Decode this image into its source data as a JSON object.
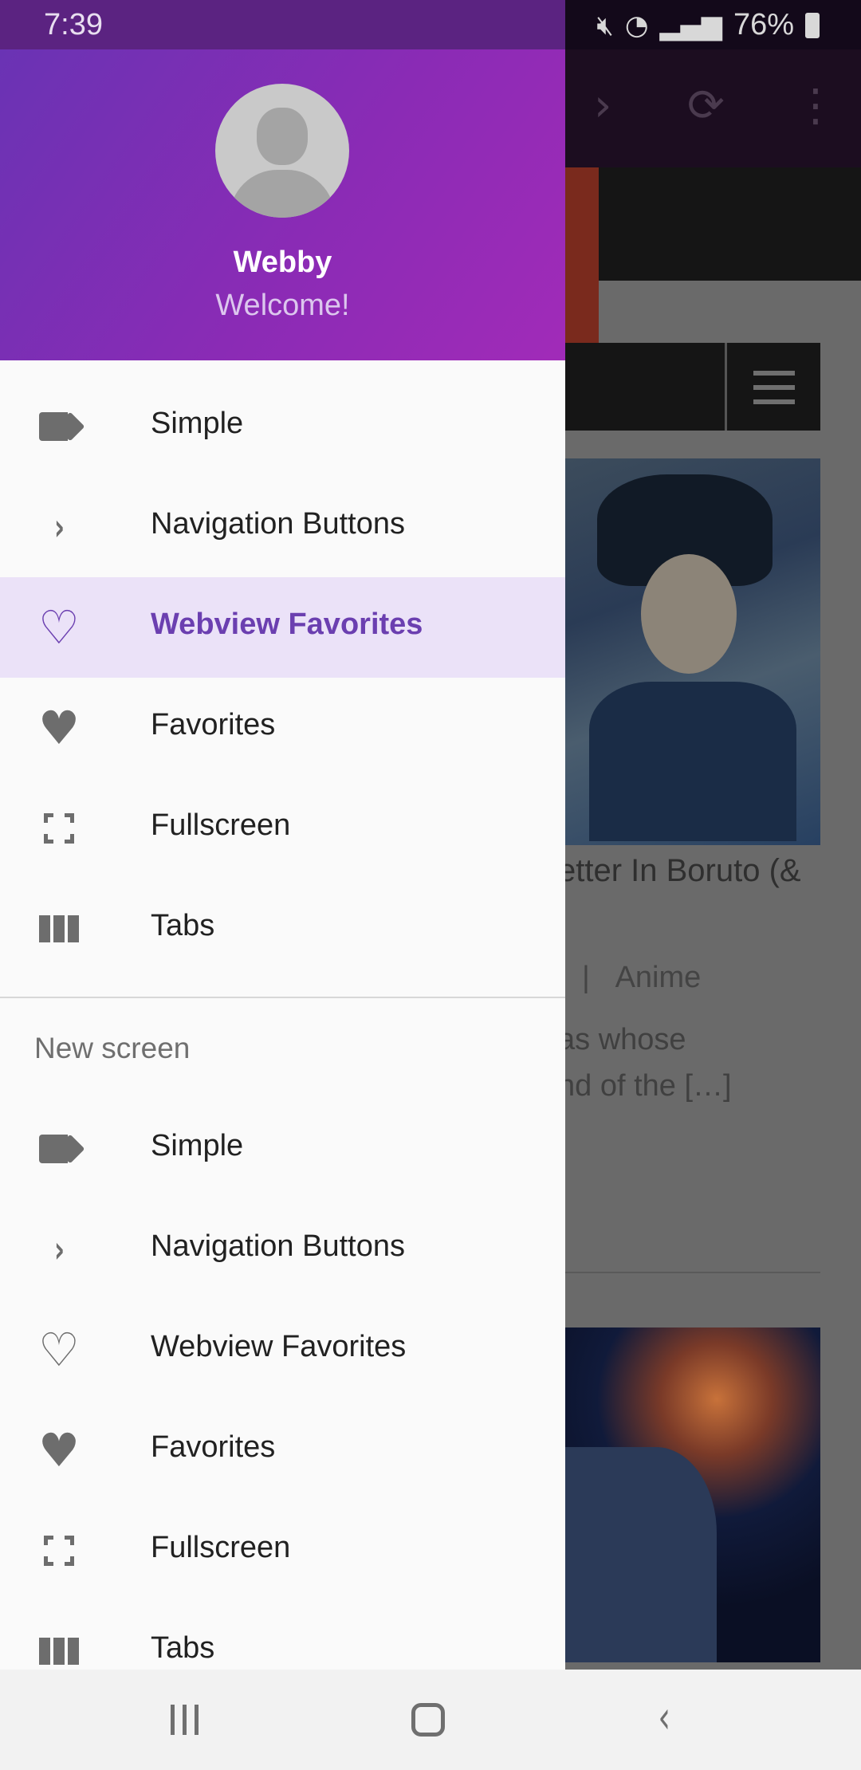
{
  "status_bar": {
    "time": "7:39",
    "battery": "76%",
    "icons": [
      "mute-icon",
      "wifi-icon",
      "signal-icon",
      "battery-icon"
    ]
  },
  "background_page": {
    "article_title": "etter In Boruto (&",
    "meta_separator": "|",
    "category": "Anime",
    "excerpt_line1": "as whose",
    "excerpt_line2": "nd of the […]"
  },
  "drawer": {
    "header": {
      "name": "Webby",
      "subtitle": "Welcome!",
      "gradient_start": "#6a33b4",
      "gradient_end": "#a12bb8"
    },
    "items": [
      {
        "label": "Simple",
        "icon": "label-icon"
      },
      {
        "label": "Navigation Buttons",
        "icon": "chevron-right-icon"
      },
      {
        "label": "Webview Favorites",
        "icon": "heart-outline-icon",
        "selected": true
      },
      {
        "label": "Favorites",
        "icon": "heart-icon"
      },
      {
        "label": "Fullscreen",
        "icon": "fullscreen-icon"
      },
      {
        "label": "Tabs",
        "icon": "view-column-icon"
      }
    ],
    "section": {
      "title": "New screen",
      "items": [
        {
          "label": "Simple",
          "icon": "label-icon"
        },
        {
          "label": "Navigation Buttons",
          "icon": "chevron-right-icon"
        },
        {
          "label": "Webview Favorites",
          "icon": "heart-outline-icon"
        },
        {
          "label": "Favorites",
          "icon": "heart-icon"
        },
        {
          "label": "Fullscreen",
          "icon": "fullscreen-icon"
        },
        {
          "label": "Tabs",
          "icon": "view-column-icon"
        }
      ]
    },
    "accent_color": "#6b3fb0",
    "selected_bg": "#ebe2f8"
  },
  "nav_bar": {
    "buttons": [
      "recent-apps-icon",
      "home-icon",
      "back-icon"
    ]
  }
}
